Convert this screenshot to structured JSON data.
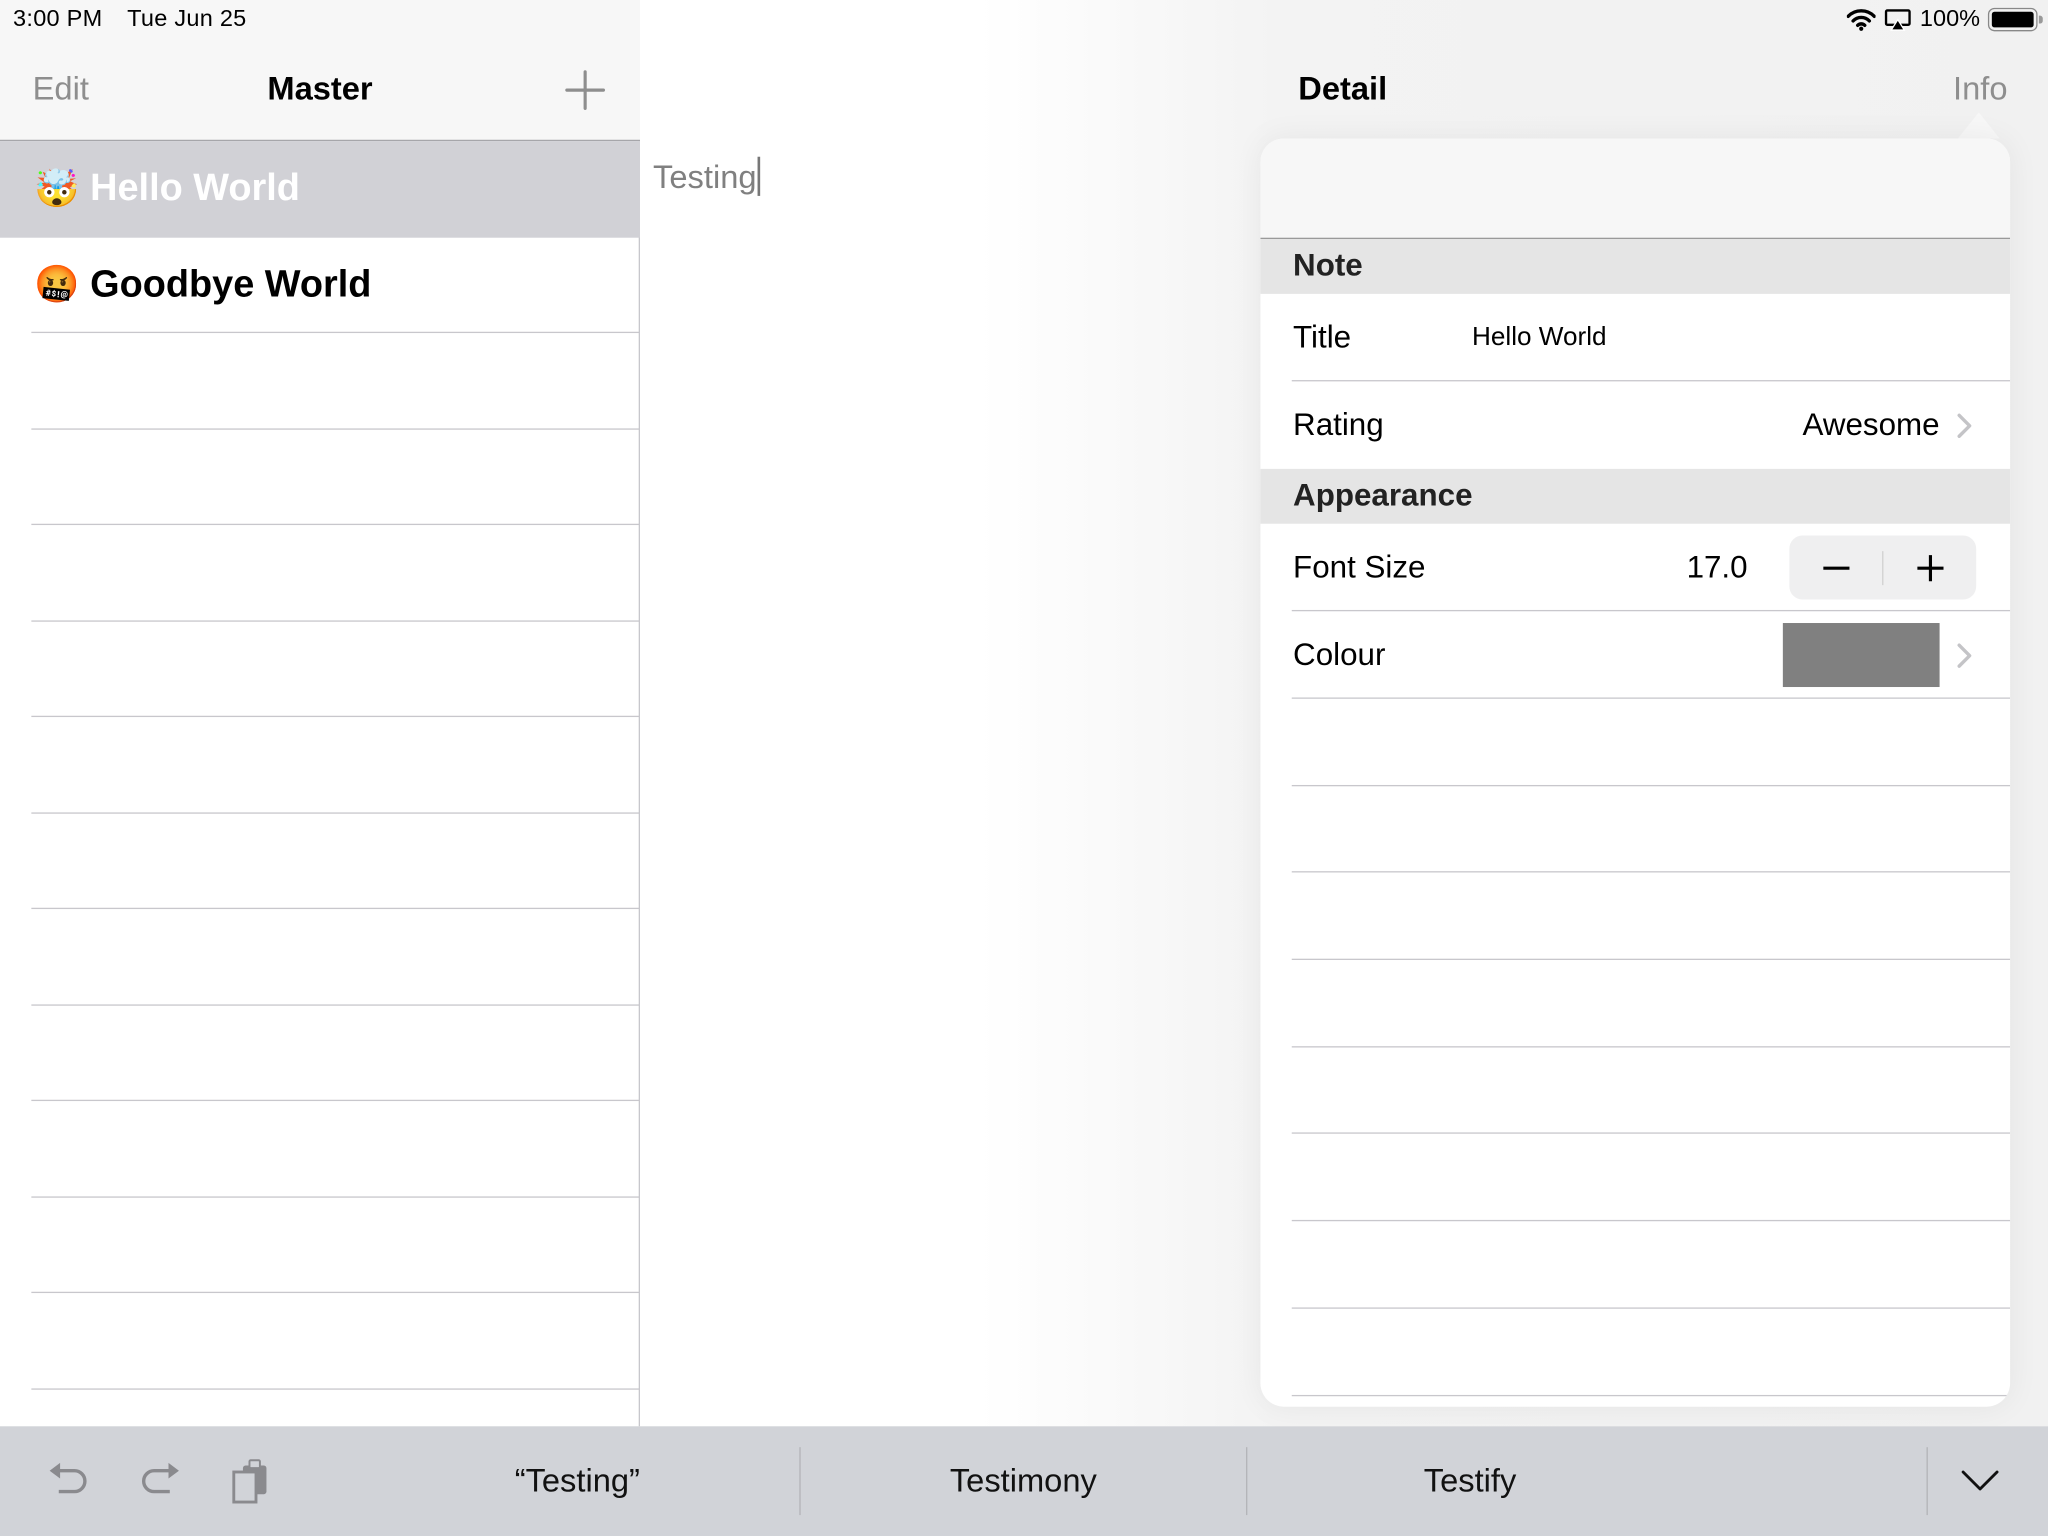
{
  "status_bar": {
    "time": "3:00 PM",
    "date": "Tue Jun 25",
    "battery_percent": "100%",
    "battery_level": 1.0,
    "icons": [
      "wifi-icon",
      "airplay-icon",
      "battery-icon"
    ]
  },
  "master": {
    "edit_label": "Edit",
    "title": "Master",
    "add_icon": "plus-icon",
    "items": [
      {
        "emoji": "🤯",
        "label": "Hello World",
        "selected": true
      },
      {
        "emoji": "🤬",
        "label": "Goodbye World",
        "selected": false
      }
    ]
  },
  "detail": {
    "title": "Detail",
    "info_label": "Info",
    "note_text": "Testing"
  },
  "popover": {
    "sections": [
      {
        "header": "Note",
        "title_label": "Title",
        "title_value": "Hello World",
        "rating_label": "Rating",
        "rating_value": "Awesome"
      },
      {
        "header": "Appearance",
        "font_size_label": "Font Size",
        "font_size_value": "17.0",
        "colour_label": "Colour",
        "colour_value": "#808080"
      }
    ]
  },
  "keyboard_bar": {
    "left_icons": [
      "undo-icon",
      "redo-icon",
      "paste-icon"
    ],
    "suggestions": [
      "“Testing”",
      "Testimony",
      "Testify"
    ],
    "dismiss_icon": "chevron-down-icon"
  },
  "colors": {
    "selection_bg": "#d1d1d6",
    "section_header_bg": "#e5e5e5",
    "keyboard_bar_bg": "#d1d3d8",
    "muted_text": "#8e8e8e"
  }
}
